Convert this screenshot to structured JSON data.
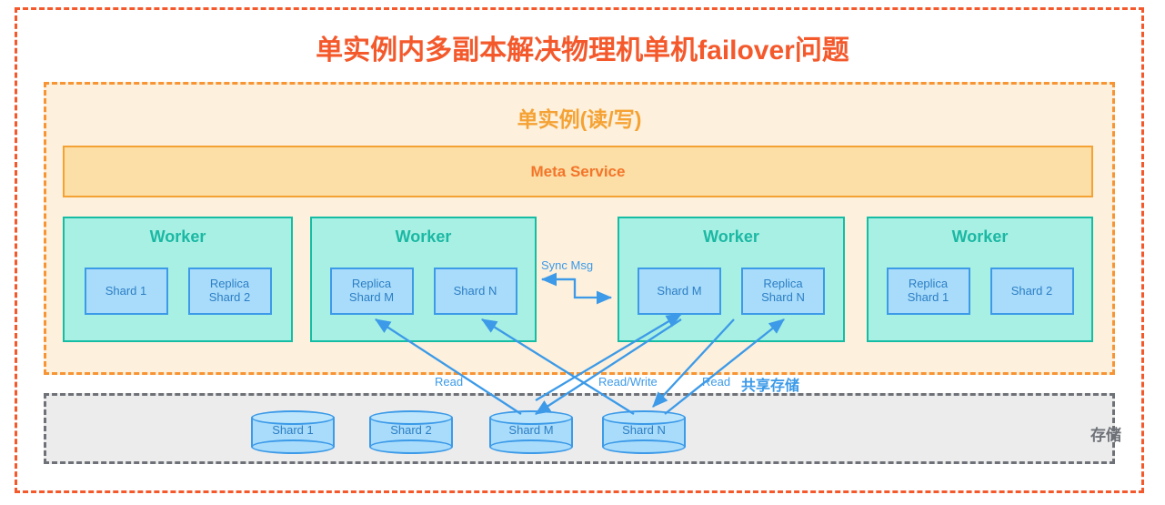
{
  "title": "单实例内多副本解决物理机单机failover问题",
  "instance": {
    "title": "单实例(读/写)",
    "meta_service": "Meta Service",
    "workers": [
      {
        "title": "Worker",
        "shards": [
          {
            "lines": [
              "Shard 1"
            ]
          },
          {
            "lines": [
              "Replica",
              "Shard 2"
            ]
          }
        ]
      },
      {
        "title": "Worker",
        "shards": [
          {
            "lines": [
              "Replica",
              "Shard M"
            ]
          },
          {
            "lines": [
              "Shard N"
            ]
          }
        ]
      },
      {
        "title": "Worker",
        "shards": [
          {
            "lines": [
              "Shard M"
            ]
          },
          {
            "lines": [
              "Replica",
              "Shard N"
            ]
          }
        ]
      },
      {
        "title": "Worker",
        "shards": [
          {
            "lines": [
              "Replica",
              "Shard 1"
            ]
          },
          {
            "lines": [
              "Shard 2"
            ]
          }
        ]
      }
    ],
    "sync_msg_label": "Sync Msg"
  },
  "io_labels": {
    "read_left": "Read",
    "read_write": "Read/Write",
    "read_right": "Read",
    "shared_storage": "共享存储"
  },
  "storage": {
    "label": "存储",
    "shards": [
      "Shard 1",
      "Shard 2",
      "Shard M",
      "Shard N"
    ]
  },
  "colors": {
    "outer_border": "#f4592c",
    "title": "#f4592c",
    "instance_border": "#f79433",
    "instance_fill": "#fdf0dc",
    "instance_title": "#f5a234",
    "meta_fill": "#fbdfa6",
    "meta_border": "#f5a234",
    "meta_text": "#f4752a",
    "worker_fill": "#a8f0e3",
    "worker_border": "#15bda5",
    "worker_title": "#1bb8a4",
    "shard_fill": "#a9dcfb",
    "shard_border": "#3c9ae8",
    "shard_text": "#2c7ec4",
    "arrow": "#3c9ae8",
    "storage_fill": "#ececec",
    "storage_border": "#6e7278",
    "storage_text": "#6e7278"
  }
}
